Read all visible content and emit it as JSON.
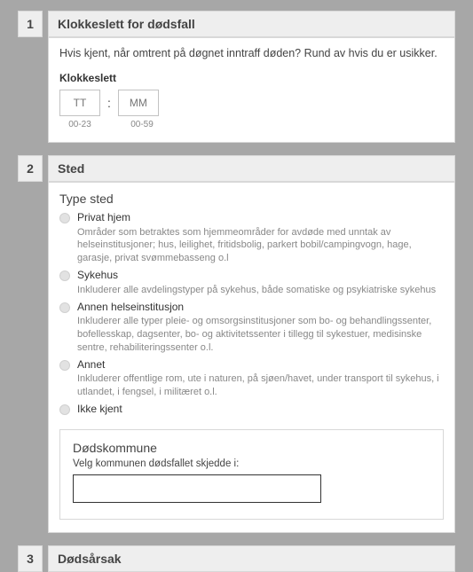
{
  "sections": [
    {
      "num": "1",
      "title": "Klokkeslett for dødsfall",
      "intro": "Hvis kjent, når omtrent på døgnet inntraff døden? Rund av hvis du er usikker.",
      "time": {
        "label": "Klokkeslett",
        "hh_placeholder": "TT",
        "mm_placeholder": "MM",
        "hh_hint": "00-23",
        "mm_hint": "00-59"
      }
    },
    {
      "num": "2",
      "title": "Sted",
      "type_label": "Type sted",
      "options": [
        {
          "label": "Privat hjem",
          "desc": "Områder som betraktes som hjemmeområder for avdøde med unntak av helseinstitusjoner; hus, leilighet, fritidsbolig, parkert bobil/campingvogn, hage, garasje, privat svømmebasseng o.l"
        },
        {
          "label": "Sykehus",
          "desc": "Inkluderer alle avdelingstyper på sykehus, både somatiske og psykiatriske sykehus"
        },
        {
          "label": "Annen helseinstitusjon",
          "desc": "Inkluderer alle typer pleie- og omsorgsinstitusjoner som bo- og behandlingssenter, bofellesskap, dagsenter, bo- og aktivitetssenter i tillegg til sykestuer, medisinske sentre, rehabiliteringssenter o.l."
        },
        {
          "label": "Annet",
          "desc": "Inkluderer offentlige rom, ute i naturen, på sjøen/havet, under transport til sykehus, i utlandet, i fengsel, i militæret o.l."
        },
        {
          "label": "Ikke kjent",
          "desc": ""
        }
      ],
      "kommune": {
        "title": "Dødskommune",
        "caption": "Velg kommunen dødsfallet skjedde i:"
      }
    },
    {
      "num": "3",
      "title": "Dødsårsak"
    }
  ]
}
